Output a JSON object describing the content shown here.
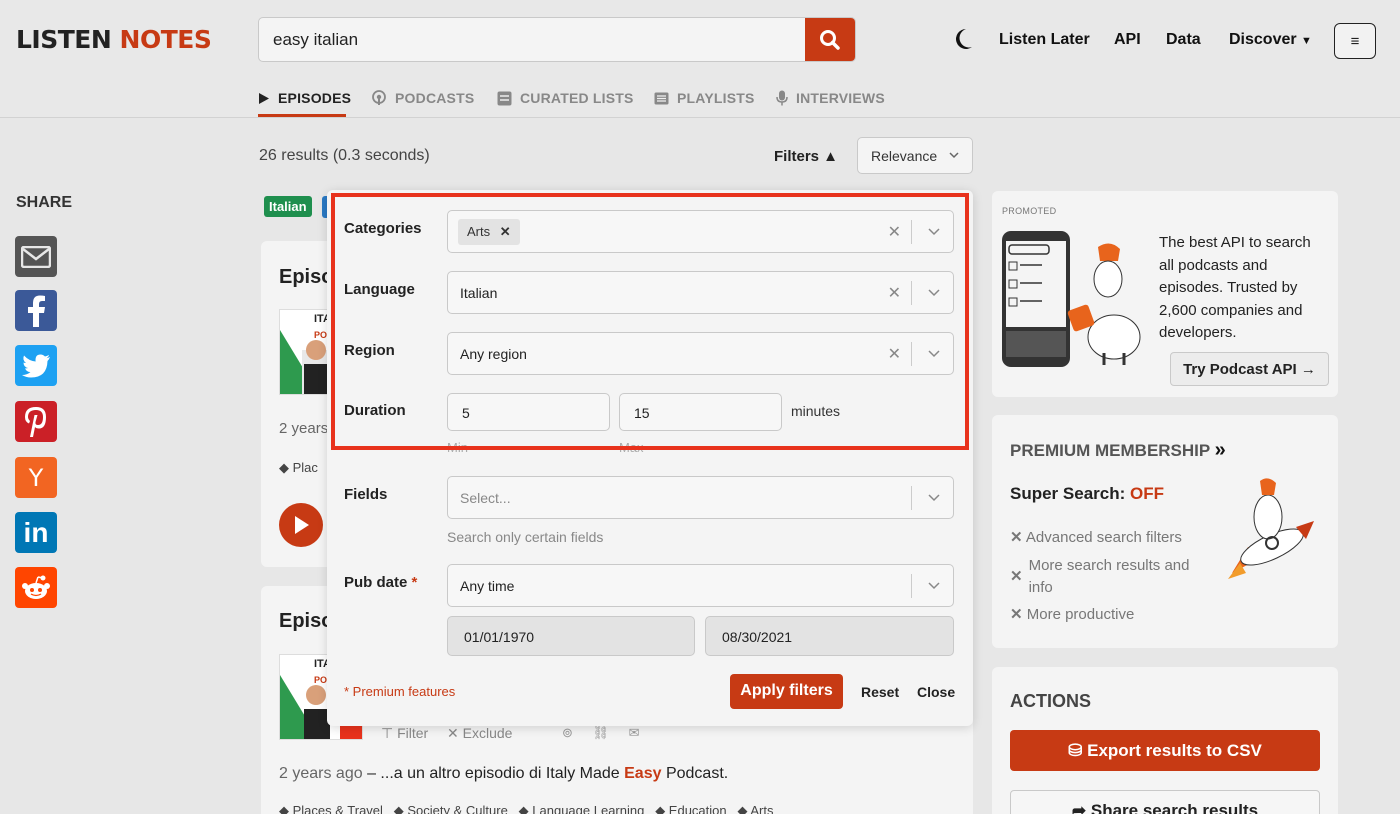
{
  "header": {
    "logo_part1": "LISTEN",
    "logo_part2": "NOTES",
    "search_value": "easy italian",
    "nav": {
      "listen_later": "Listen Later",
      "api": "API",
      "data": "Data",
      "discover": "Discover",
      "menu_glyph": "≡"
    },
    "tabs": [
      {
        "label": "EPISODES",
        "icon": "play-icon",
        "active": true
      },
      {
        "label": "PODCASTS",
        "icon": "podcast-icon",
        "active": false
      },
      {
        "label": "CURATED LISTS",
        "icon": "list-icon",
        "active": false
      },
      {
        "label": "PLAYLISTS",
        "icon": "playlist-icon",
        "active": false
      },
      {
        "label": "INTERVIEWS",
        "icon": "microphone-icon",
        "active": false
      }
    ]
  },
  "results": {
    "count_text": "26 results (0.3 seconds)",
    "filters_label": "Filters ▲",
    "sort_value": "Relevance"
  },
  "share": {
    "label": "SHARE",
    "icons": [
      "email-icon",
      "facebook-icon",
      "twitter-icon",
      "pinterest-icon",
      "hackernews-icon",
      "linkedin-icon",
      "reddit-icon"
    ]
  },
  "cards": {
    "lang_chip": "Italian",
    "card1_title": "Episo",
    "card1_age": "2 years",
    "card1_tag": "Plac",
    "card2_title": "Episo",
    "card2_filter": "Filter",
    "card2_exclude": "Exclude",
    "card2_age": "2 years ago",
    "card2_dash": "–",
    "card2_snippet_pre": "...a un altro episodio di Italy Made",
    "card2_snippet_hl": "Easy",
    "card2_snippet_post": "Podcast.",
    "card2_tags": [
      "Places & Travel",
      "Society & Culture",
      "Language Learning",
      "Education",
      "Arts"
    ]
  },
  "filters": {
    "categories_label": "Categories",
    "categories_chip": "Arts",
    "language_label": "Language",
    "language_value": "Italian",
    "region_label": "Region",
    "region_value": "Any region",
    "duration_label": "Duration",
    "duration_min": "5",
    "duration_max": "15",
    "duration_unit": "minutes",
    "min_hint": "Min",
    "max_hint": "Max",
    "fields_label": "Fields",
    "fields_placeholder": "Select...",
    "fields_hint": "Search only certain fields",
    "pubdate_label": "Pub date",
    "pubdate_star": "*",
    "pubdate_value": "Any time",
    "date_from": "01/01/1970",
    "date_to": "08/30/2021",
    "premium_note": "* Premium features",
    "apply": "Apply filters",
    "reset": "Reset",
    "close": "Close",
    "clear_glyph": "✕"
  },
  "promo": {
    "label": "PROMOTED",
    "text": "The best API to search all podcasts and episodes. Trusted by 2,600 companies and developers.",
    "button": "Try Podcast API →"
  },
  "premium": {
    "title": "PREMIUM MEMBERSHIP",
    "arrows": "»",
    "super_label": "Super Search:",
    "super_state": "OFF",
    "items": [
      "Advanced search filters",
      "More search results and info",
      "More productive"
    ]
  },
  "actions": {
    "title": "ACTIONS",
    "export": "Export results to CSV",
    "share_results": "Share search results"
  },
  "colors": {
    "brand": "#c73a14",
    "highlight": "#e8321c",
    "background": "#e7e7e7"
  }
}
